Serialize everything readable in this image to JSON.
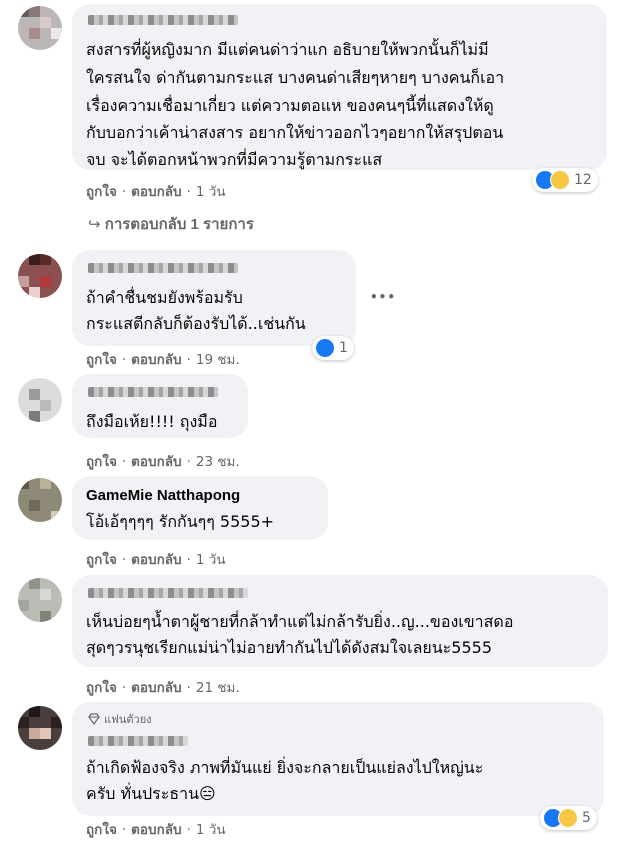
{
  "common": {
    "like_label": "ถูกใจ",
    "reply_label": "ตอบกลับ",
    "separator": "·"
  },
  "comments": [
    {
      "name": "",
      "lines": [
        "สงสารที่ผู้หญิงมาก มีแต่คนด่าว่าแก อธิบายให้พวกนั้นก็ไม่มี",
        "ใครสนใจ ด่ากันตามกระแส บางคนด่าเสียๆหายๆ บางคนก็เอา",
        "เรื่องความเชื่อมาเกี่ยว แต่ความตอแห ของคนๆนี้ที่แสดงให้ดู",
        "กับบอกว่าเค้าน่าสงสาร อยากให้ข่าวออกไวๆอยากให้สรุปตอน",
        "จบ จะได้ตอกหน้าพวกที่มีความรู้ตามกระแส"
      ],
      "time": "1 วัน",
      "reaction_count": "12",
      "replies_label": "การตอบกลับ 1 รายการ"
    },
    {
      "name": "",
      "lines": [
        "ถ้าคำชื่นชมยังพร้อมรับ",
        "กระแสตีกลับก็ต้องรับได้..เช่นกัน"
      ],
      "time": "19 ชม.",
      "reaction_count": "1",
      "more_label": "•••"
    },
    {
      "name": "",
      "lines": [
        "ถึงมือเห้ย!!!! ถุงมือ"
      ],
      "time": "23 ชม."
    },
    {
      "name": "GameMie Natthapong",
      "lines": [
        "โอ้เอ้ๆๆๆๆ รักกันๆๆ 5555+"
      ],
      "time": "1 วัน"
    },
    {
      "name": "",
      "lines": [
        "เห็นบ่อยๆน้ำตาผู้ชายที่กล้าทำแต่ไม่กล้ารับยิ่ง..ญ...ของเขาสดอ",
        "สุดๆวรนุชเรียกแม่น่าไม่อายทำกันไปได้ดังสมใจเลยนะ5555"
      ],
      "time": "21 ชม."
    },
    {
      "name": "",
      "badge": "แฟนตัวยง",
      "lines": [
        "ถ้าเกิดฟ้องจริง ภาพที่มันแย่ ยิ่งจะกลายเป็นแย่ลงไปใหญ่นะ",
        "ครับ ทั่นประธาน😑"
      ],
      "time": "1 วัน",
      "reaction_count": "5"
    }
  ]
}
